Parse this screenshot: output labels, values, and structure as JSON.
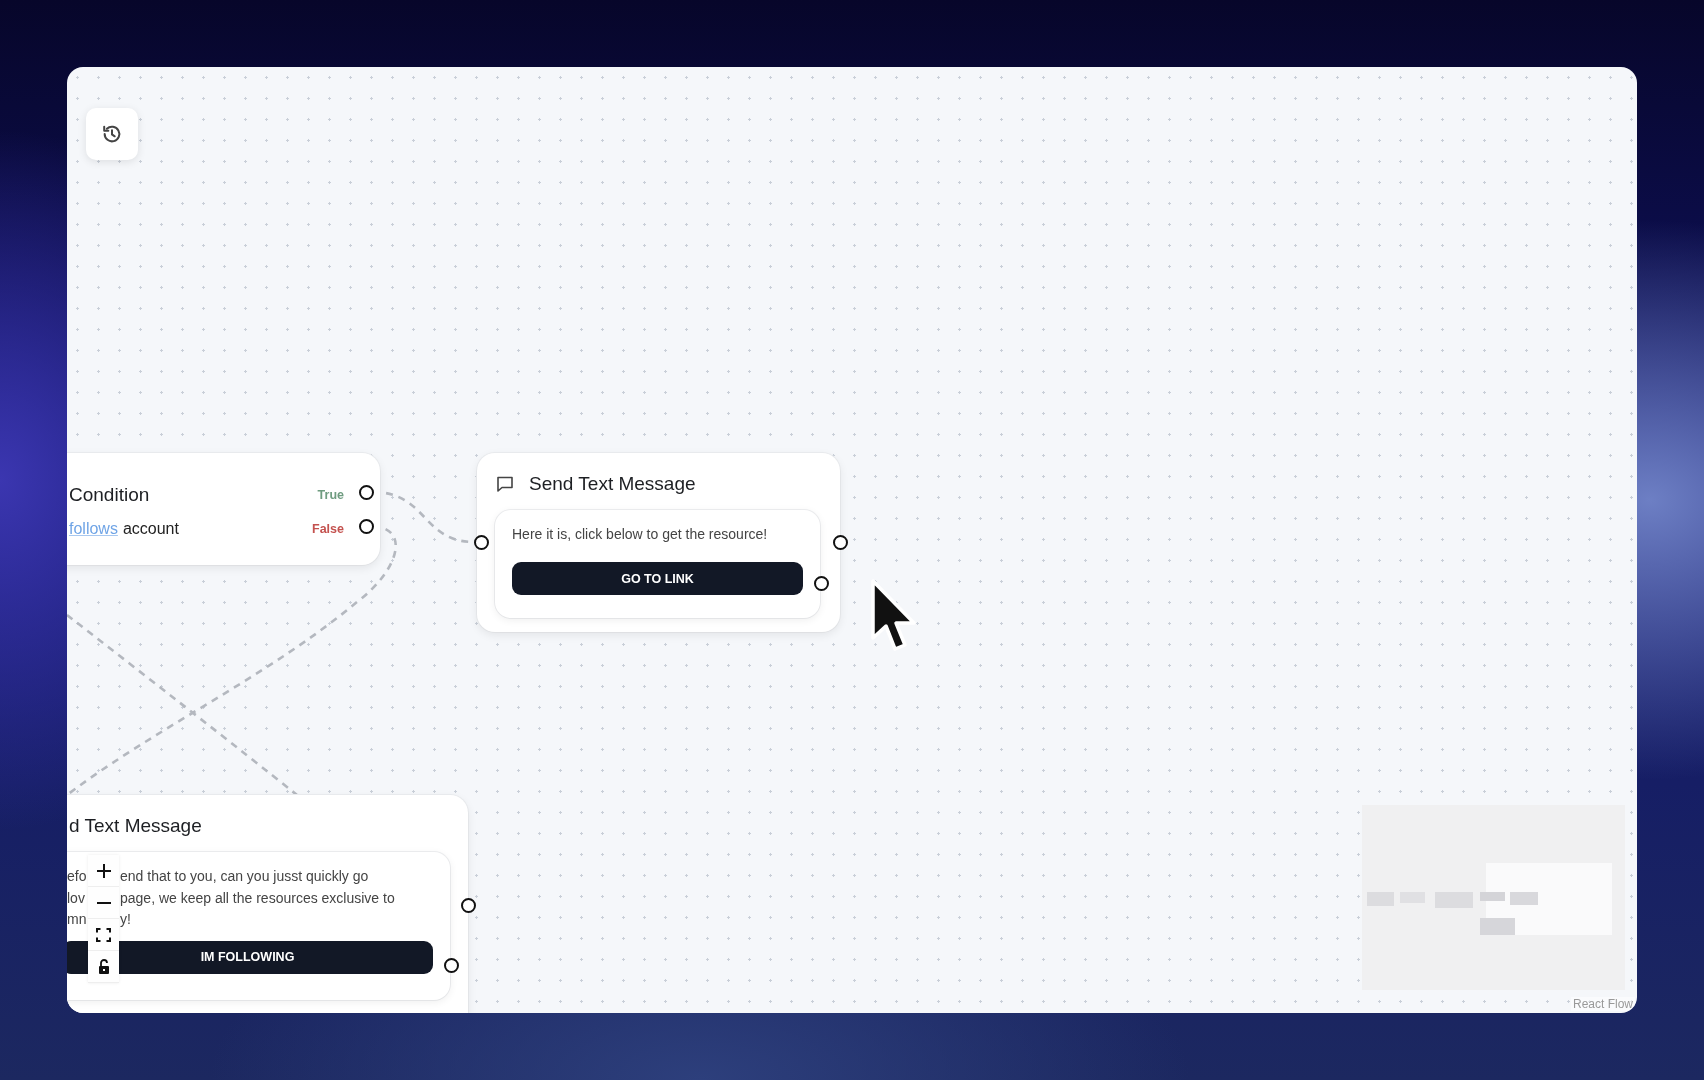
{
  "nodes": [
    {
      "kind": "condition",
      "title": "Condition",
      "variable": "follows",
      "rest": "account",
      "outputs": [
        {
          "label": "True",
          "color": "#6f9c80"
        },
        {
          "label": "False",
          "color": "#c4524f"
        }
      ]
    },
    {
      "kind": "message",
      "title": "Send Text Message",
      "lines": [
        {
          "right": "Here it is, click below to get the resource!"
        }
      ],
      "button": "GO TO LINK"
    },
    {
      "kind": "message",
      "title": "d Text Message",
      "lines": [
        {
          "left": "efo",
          "right": "end that to you, can you jusst quickly go"
        },
        {
          "left": "lov",
          "right": "page, we keep all the resources exclusive to"
        },
        {
          "left": "mn",
          "right": "y!"
        }
      ],
      "button": "IM FOLLOWING"
    }
  ],
  "controls": {
    "locked": false
  },
  "attribution": "React Flow"
}
